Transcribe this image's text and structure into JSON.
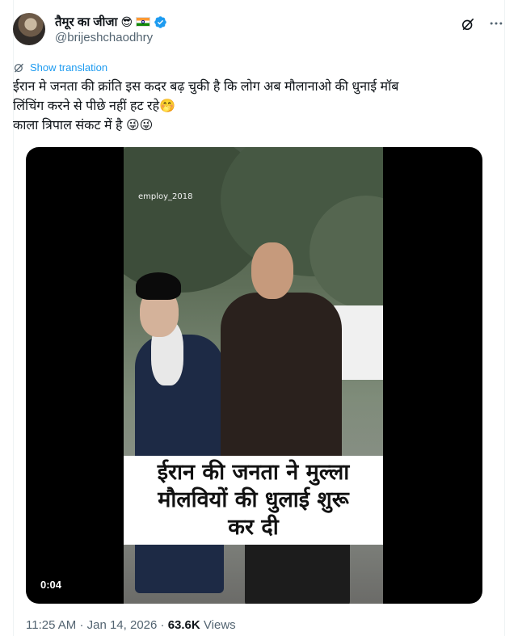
{
  "author": {
    "display_name": "तैमूर का जीजा",
    "name_emoji": "😎",
    "handle": "@brijeshchaodhry",
    "verified": true
  },
  "tweet": {
    "translate_label": "Show translation",
    "text": "ईरान मे जनता की क्रांति इस कदर बढ़ चुकी है कि लोग अब  मौलानाओ की धुनाई मॉब\nलिंचिंग करने से पीछे नहीं हट रहे🤭\nकाला त्रिपाल संकट में है 😜😜"
  },
  "media": {
    "watermark": "employ_2018",
    "caption_lines": [
      "ईरान की जनता ने मुल्ला",
      "मौलवियों की धुलाई शुरू",
      "कर दी"
    ],
    "duration": "0:04"
  },
  "meta": {
    "time": "11:25 AM",
    "separator": "·",
    "date": "Jan 14, 2026",
    "views_count": "63.6K",
    "views_label": "Views"
  },
  "colors": {
    "accent": "#1d9bf0",
    "secondary_text": "#536471",
    "primary_text": "#0f1419"
  },
  "icons": [
    "verified-badge-icon",
    "flag-india-icon",
    "grok-icon",
    "more-icon",
    "translate-icon"
  ]
}
